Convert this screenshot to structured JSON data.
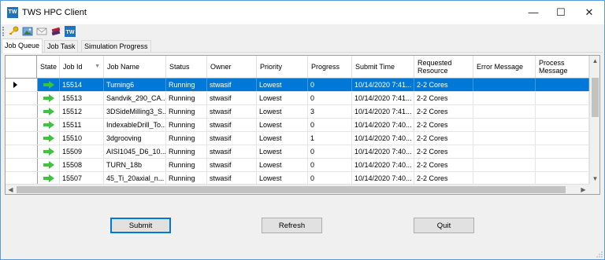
{
  "window": {
    "title": "TWS HPC Client",
    "app_icon": "TW",
    "minimize": "—",
    "maximize": "☐",
    "close": "✕"
  },
  "toolbar": {
    "icons": [
      "key-icon",
      "image-icon",
      "mail-icon",
      "books-icon",
      "tw-icon"
    ],
    "tw_label": "TW"
  },
  "tabs": [
    {
      "label": "Job Queue",
      "active": true
    },
    {
      "label": "Job Task",
      "active": false
    },
    {
      "label": "Simulation Progress",
      "active": false
    }
  ],
  "grid": {
    "columns": [
      "State",
      "Job Id",
      "Job Name",
      "Status",
      "Owner",
      "Priority",
      "Progress",
      "Submit Time",
      "Requested Resource",
      "Error Message",
      "Process Message"
    ],
    "sort_indicator": "▼",
    "rows": [
      {
        "job_id": "15514",
        "job_name": "Turning6",
        "status": "Running",
        "owner": "stwasif",
        "priority": "Lowest",
        "progress": "0",
        "submit_time": "10/14/2020 7:41...",
        "requested_resource": "2-2 Cores",
        "error_message": "",
        "process_message": "",
        "selected": true
      },
      {
        "job_id": "15513",
        "job_name": "Sandvik_290_CA...",
        "status": "Running",
        "owner": "stwasif",
        "priority": "Lowest",
        "progress": "0",
        "submit_time": "10/14/2020 7:41...",
        "requested_resource": "2-2 Cores",
        "error_message": "",
        "process_message": ""
      },
      {
        "job_id": "15512",
        "job_name": "3DSideMilling3_S...",
        "status": "Running",
        "owner": "stwasif",
        "priority": "Lowest",
        "progress": "3",
        "submit_time": "10/14/2020 7:41...",
        "requested_resource": "2-2 Cores",
        "error_message": "",
        "process_message": ""
      },
      {
        "job_id": "15511",
        "job_name": "IndexableDrill_To...",
        "status": "Running",
        "owner": "stwasif",
        "priority": "Lowest",
        "progress": "0",
        "submit_time": "10/14/2020 7:40...",
        "requested_resource": "2-2 Cores",
        "error_message": "",
        "process_message": ""
      },
      {
        "job_id": "15510",
        "job_name": "3dgrooving",
        "status": "Running",
        "owner": "stwasif",
        "priority": "Lowest",
        "progress": "1",
        "submit_time": "10/14/2020 7:40...",
        "requested_resource": "2-2 Cores",
        "error_message": "",
        "process_message": ""
      },
      {
        "job_id": "15509",
        "job_name": "AISI1045_D6_10...",
        "status": "Running",
        "owner": "stwasif",
        "priority": "Lowest",
        "progress": "0",
        "submit_time": "10/14/2020 7:40...",
        "requested_resource": "2-2 Cores",
        "error_message": "",
        "process_message": ""
      },
      {
        "job_id": "15508",
        "job_name": "TURN_18b",
        "status": "Running",
        "owner": "stwasif",
        "priority": "Lowest",
        "progress": "0",
        "submit_time": "10/14/2020 7:40...",
        "requested_resource": "2-2 Cores",
        "error_message": "",
        "process_message": ""
      },
      {
        "job_id": "15507",
        "job_name": "45_Ti_20axial_n...",
        "status": "Running",
        "owner": "stwasif",
        "priority": "Lowest",
        "progress": "0",
        "submit_time": "10/14/2020 7:40...",
        "requested_resource": "2-2 Cores",
        "error_message": "",
        "process_message": ""
      }
    ]
  },
  "buttons": {
    "submit": "Submit",
    "refresh": "Refresh",
    "quit": "Quit"
  },
  "colors": {
    "selection": "#0078d7",
    "state_arrow": "#3cc43c",
    "app_icon_bg": "#1e73be"
  }
}
